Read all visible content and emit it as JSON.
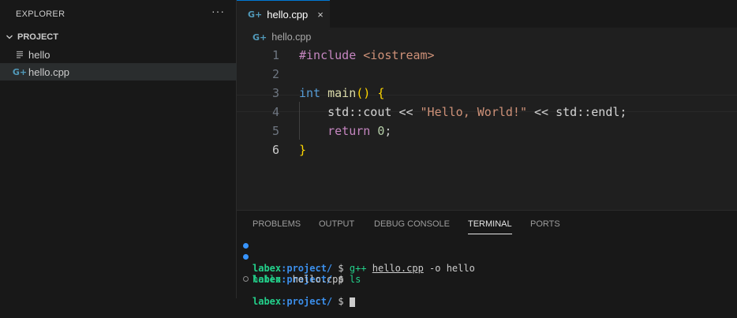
{
  "sidebar": {
    "title": "EXPLORER",
    "more": "···",
    "project": "PROJECT",
    "files": [
      {
        "name": "hello",
        "icon": "text-file-icon"
      },
      {
        "name": "hello.cpp",
        "icon": "cpp-file-icon"
      }
    ]
  },
  "editor": {
    "tab": {
      "label": "hello.cpp",
      "close": "×",
      "icon": "cpp-file-icon"
    },
    "breadcrumb": "hello.cpp",
    "active_line": 6,
    "lines": [
      {
        "n": "1",
        "text": "#include <iostream>"
      },
      {
        "n": "2",
        "text": ""
      },
      {
        "n": "3",
        "text": "int main() {"
      },
      {
        "n": "4",
        "text": "    std::cout << \"Hello, World!\" << std::endl;"
      },
      {
        "n": "5",
        "text": "    return 0;"
      },
      {
        "n": "6",
        "text": "}"
      }
    ]
  },
  "panel": {
    "tabs": [
      "PROBLEMS",
      "OUTPUT",
      "DEBUG CONSOLE",
      "TERMINAL",
      "PORTS"
    ],
    "active_tab": "TERMINAL",
    "terminal": {
      "user": "labex",
      "path": ":project/",
      "prompt": "$",
      "lines": [
        {
          "cmd": "g++",
          "arg1": "hello.cpp",
          "rest": " -o hello"
        },
        {
          "cmd": "ls"
        }
      ],
      "output": {
        "exe": "hello",
        "file": "hello.cpp"
      }
    }
  },
  "colors": {
    "accent": "#0078d4",
    "prompt_user": "#23d18b",
    "prompt_path": "#3b8eea"
  }
}
